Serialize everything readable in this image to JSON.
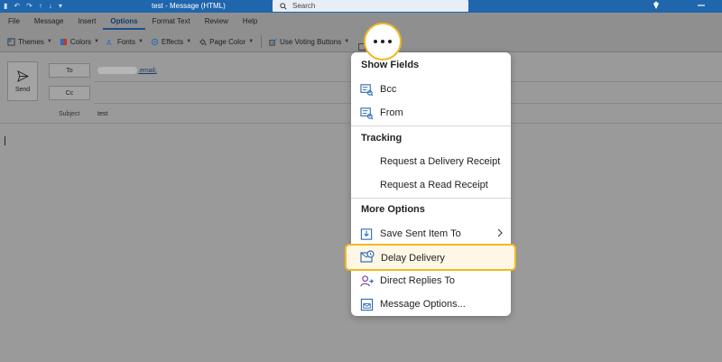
{
  "titlebar": {
    "title": "test  -  Message (HTML)",
    "search_placeholder": "Search"
  },
  "ribbon": {
    "tabs": [
      {
        "label": "File"
      },
      {
        "label": "Message"
      },
      {
        "label": "Insert"
      },
      {
        "label": "Options",
        "active": true
      },
      {
        "label": "Format Text"
      },
      {
        "label": "Review"
      },
      {
        "label": "Help"
      }
    ],
    "commands": {
      "themes": "Themes",
      "colors": "Colors",
      "fonts": "Fonts",
      "effects": "Effects",
      "page_color": "Page Color",
      "voting": "Use Voting Buttons"
    }
  },
  "compose": {
    "send_label": "Send",
    "to_label": "To",
    "cc_label": "Cc",
    "to_value_suffix": ".email;",
    "subject_label": "Subject",
    "subject_value": "test"
  },
  "menu": {
    "show_fields": {
      "header": "Show Fields",
      "bcc": "Bcc",
      "from": "From"
    },
    "tracking": {
      "header": "Tracking",
      "delivery_receipt": "Request a Delivery Receipt",
      "read_receipt": "Request a Read Receipt"
    },
    "more_options": {
      "header": "More Options",
      "save_sent_item": "Save Sent Item To",
      "delay_delivery": "Delay Delivery",
      "direct_replies": "Direct Replies To",
      "message_options": "Message Options..."
    }
  },
  "colors": {
    "titlebar": "#1f66ad",
    "highlight": "#f2b822",
    "icon_blue": "#2f6db5",
    "icon_purple": "#7b3fa0"
  }
}
